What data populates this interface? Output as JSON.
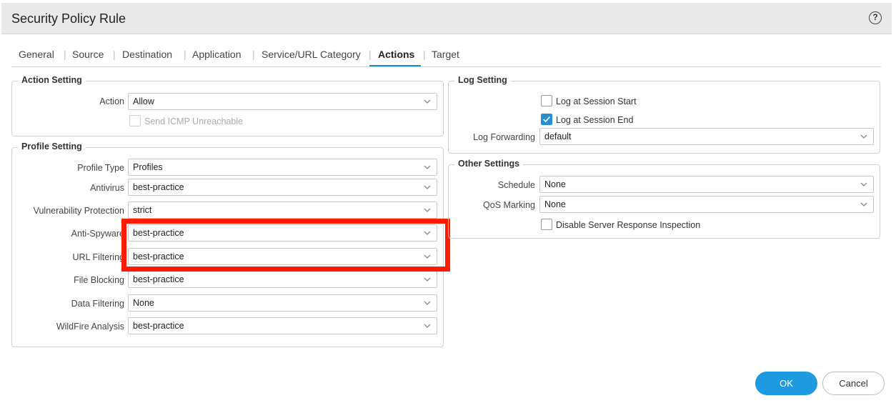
{
  "dialog": {
    "title": "Security Policy Rule",
    "help_label": "?"
  },
  "tabs": [
    {
      "label": "General"
    },
    {
      "label": "Source"
    },
    {
      "label": "Destination"
    },
    {
      "label": "Application"
    },
    {
      "label": "Service/URL Category"
    },
    {
      "label": "Actions"
    },
    {
      "label": "Target"
    }
  ],
  "tab_separator": "|",
  "action_setting": {
    "legend": "Action Setting",
    "action_label": "Action",
    "action_value": "Allow",
    "icmp_label": "Send ICMP Unreachable"
  },
  "profile_setting": {
    "legend": "Profile Setting",
    "rows": [
      {
        "label": "Profile Type",
        "value": "Profiles"
      },
      {
        "label": "Antivirus",
        "value": "best-practice"
      },
      {
        "label": "Vulnerability Protection",
        "value": "strict"
      },
      {
        "label": "Anti-Spyware",
        "value": "best-practice"
      },
      {
        "label": "URL Filtering",
        "value": "best-practice"
      },
      {
        "label": "File Blocking",
        "value": "best-practice"
      },
      {
        "label": "Data Filtering",
        "value": "None"
      },
      {
        "label": "WildFire Analysis",
        "value": "best-practice"
      }
    ]
  },
  "log_setting": {
    "legend": "Log Setting",
    "log_start_label": "Log at Session Start",
    "log_end_label": "Log at Session End",
    "forwarding_label": "Log Forwarding",
    "forwarding_value": "default"
  },
  "other_settings": {
    "legend": "Other Settings",
    "schedule_label": "Schedule",
    "schedule_value": "None",
    "qos_label": "QoS Marking",
    "qos_value": "None",
    "disable_inspection_label": "Disable Server Response Inspection"
  },
  "footer": {
    "ok_label": "OK",
    "cancel_label": "Cancel"
  },
  "colors": {
    "accent": "#1e9be0",
    "highlight": "#ff1a00"
  }
}
